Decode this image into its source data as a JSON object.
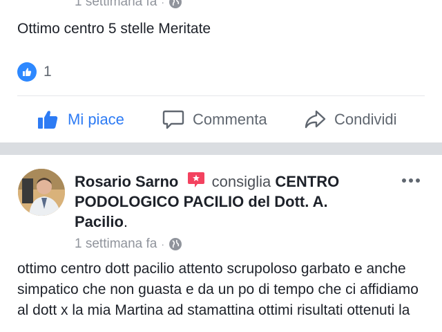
{
  "post1": {
    "timestamp": "1 settimana fa",
    "separator": "·",
    "audience_icon": "globe-icon",
    "text": "Ottimo centro 5 stelle Meritate",
    "reaction_icon": "like-icon",
    "reaction_count": "1"
  },
  "actions": {
    "like": "Mi piace",
    "comment": "Commenta",
    "share": "Condividi"
  },
  "post2": {
    "author": "Rosario Sarno",
    "badge_icon": "recommendation-icon",
    "verb": "consiglia",
    "page_name": "CENTRO PODOLOGICO PACILIO del Dott. A. Pacilio",
    "period": ".",
    "timestamp": "1 settimana fa",
    "separator": "·",
    "audience_icon": "globe-icon",
    "text": "ottimo centro dott pacilio attento scrupoloso garbato e anche simpatico che non guasta e da un po di tempo che ci affidiamo al dott x la mia Martina ad stamattina ottimi risultati ottenuti la"
  },
  "colors": {
    "accent_blue": "#2d7bf4",
    "text_primary": "#1d2129",
    "text_secondary": "#606770",
    "meta_gray": "#90949c",
    "separator": "#dadde1",
    "badge_red": "#f3425f"
  }
}
